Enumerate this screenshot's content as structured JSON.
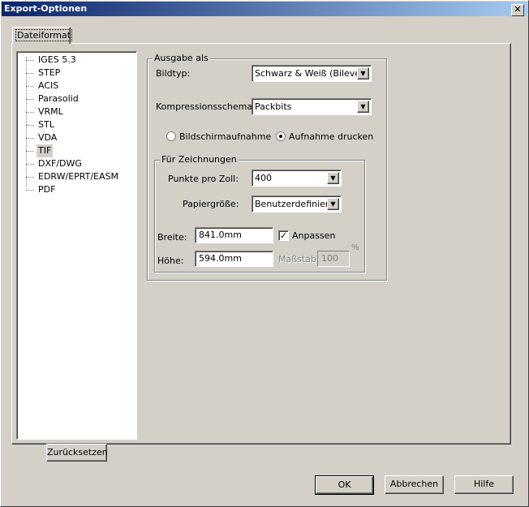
{
  "window": {
    "title": "Export-Optionen",
    "close": "✕"
  },
  "tabs": [
    {
      "label": "Dateiformat"
    }
  ],
  "formats": [
    "IGES 5.3",
    "STEP",
    "ACIS",
    "Parasolid",
    "VRML",
    "STL",
    "VDA",
    "TIF",
    "DXF/DWG",
    "EDRW/EPRT/EASM",
    "PDF"
  ],
  "selected_format": "TIF",
  "reset_label": "Zurücksetzen",
  "output": {
    "group_label": "Ausgabe als",
    "image_type_label": "Bildtyp:",
    "image_type_value": "Schwarz & Weiß (Bilevel)",
    "compression_label": "Kompressionsschema:",
    "compression_value": "Packbits",
    "radio_screen": "Bildschirmaufnahme",
    "radio_print": "Aufnahme drucken",
    "selected_radio": "print"
  },
  "drawings": {
    "group_label": "Für Zeichnungen",
    "dpi_label": "Punkte pro Zoll:",
    "dpi_value": "400",
    "paper_label": "Papiergröße:",
    "paper_value": "Benutzerdefiniert",
    "width_label": "Breite:",
    "width_value": "841.0mm",
    "height_label": "Höhe:",
    "height_value": "594.0mm",
    "fit_label": "Anpassen",
    "fit_checked": true,
    "scale_label": "Maßstab:",
    "scale_value": "100",
    "percent": "%"
  },
  "buttons": {
    "ok": "OK",
    "cancel": "Abbrechen",
    "help": "Hilfe"
  }
}
